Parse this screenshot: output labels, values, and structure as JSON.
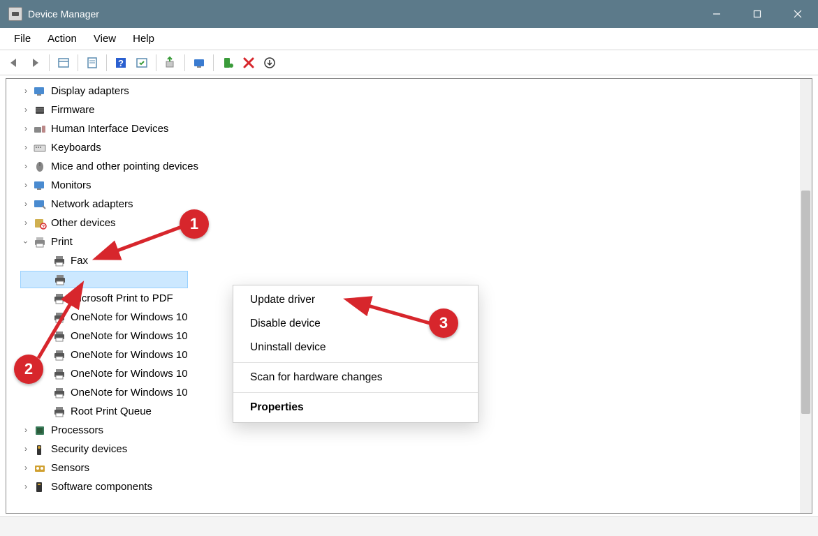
{
  "window": {
    "title": "Device Manager"
  },
  "menu": {
    "file": "File",
    "action": "Action",
    "view": "View",
    "help": "Help"
  },
  "tree": {
    "display_adapters": "Display adapters",
    "firmware": "Firmware",
    "hid": "Human Interface Devices",
    "keyboards": "Keyboards",
    "mice": "Mice and other pointing devices",
    "monitors": "Monitors",
    "network_adapters": "Network adapters",
    "other_devices": "Other devices",
    "print": "Print",
    "print_children": {
      "fax": "Fax",
      "selected": "",
      "ms_print_pdf": "Microsoft Print to PDF",
      "onenote1": "OneNote for Windows 10",
      "onenote2": "OneNote for Windows 10",
      "onenote3": "OneNote for Windows 10",
      "onenote4": "OneNote for Windows 10",
      "onenote5": "OneNote for Windows 10",
      "root_queue": "Root Print Queue"
    },
    "processors": "Processors",
    "security_devices": "Security devices",
    "sensors": "Sensors",
    "software_components": "Software components"
  },
  "context_menu": {
    "update_driver": "Update driver",
    "disable_device": "Disable device",
    "uninstall_device": "Uninstall device",
    "scan_hardware": "Scan for hardware changes",
    "properties": "Properties"
  },
  "annotations": {
    "one": "1",
    "two": "2",
    "three": "3"
  }
}
